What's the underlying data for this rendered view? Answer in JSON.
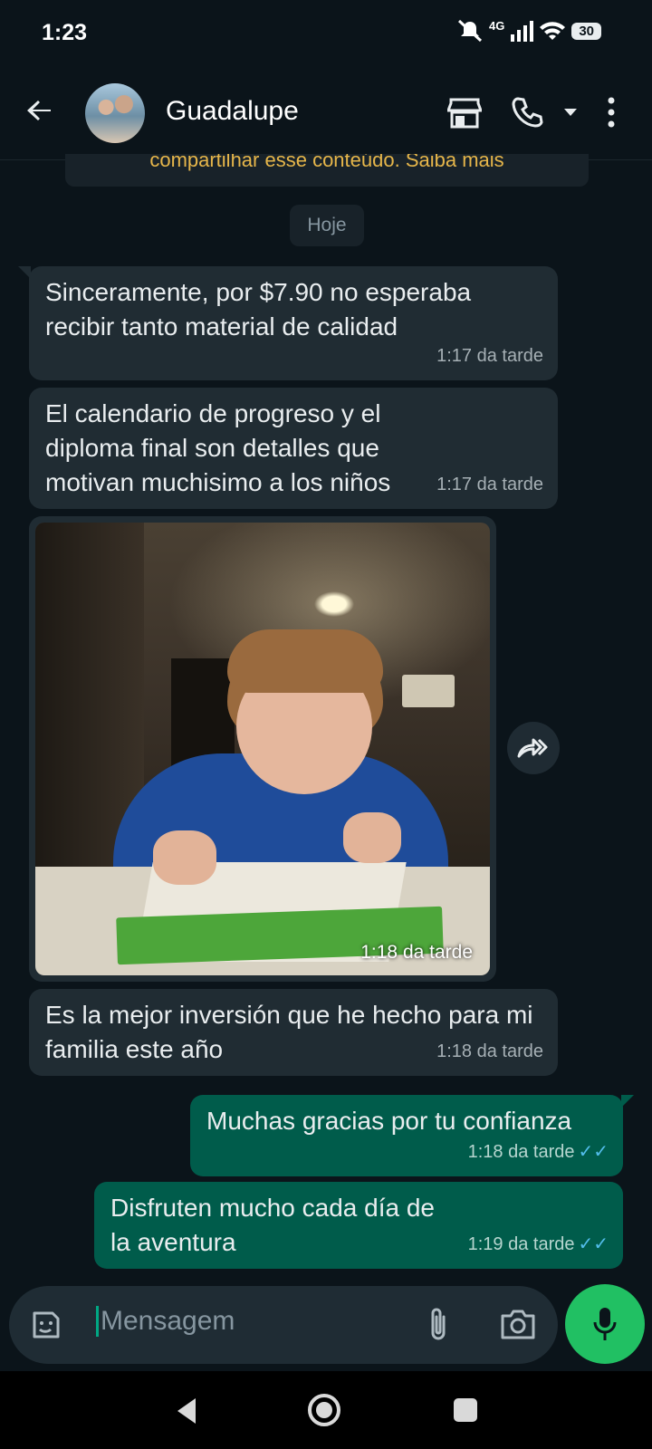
{
  "status_bar": {
    "time": "1:23",
    "network": "4G",
    "battery": "30"
  },
  "header": {
    "contact_name": "Guadalupe"
  },
  "banner": {
    "text": "compartilhar esse conteúdo. Saiba mais"
  },
  "date_chip": "Hoje",
  "messages": [
    {
      "direction": "in",
      "text": "Sinceramente, por $7.90 no esperaba recibir tanto material de calidad",
      "time": "1:17 da tarde"
    },
    {
      "direction": "in",
      "text": "El calendario de progreso y el diploma final son detalles que motivan muchisimo a los niños",
      "time": "1:17 da tarde"
    },
    {
      "direction": "in",
      "type": "image",
      "time": "1:18 da tarde"
    },
    {
      "direction": "in",
      "text": "Es la mejor inversión que he hecho para mi familia este año",
      "time": "1:18 da tarde"
    },
    {
      "direction": "out",
      "text": "Muchas gracias por tu confianza",
      "time": "1:18 da tarde",
      "status": "read"
    },
    {
      "direction": "out",
      "text": "Disfruten mucho cada día de la aventura",
      "time": "1:19 da tarde",
      "status": "read"
    }
  ],
  "composer": {
    "placeholder": "Mensagem"
  },
  "colors": {
    "background": "#0b141a",
    "incoming": "#202c33",
    "outgoing": "#005c4b",
    "accent": "#21c063",
    "read_ticks": "#53bdeb"
  },
  "icons": [
    "back-arrow-icon",
    "store-icon",
    "phone-icon",
    "dropdown-icon",
    "more-vert-icon",
    "forward-icon",
    "sticker-icon",
    "attach-icon",
    "camera-icon",
    "mic-icon",
    "nav-back-icon",
    "nav-home-icon",
    "nav-recents-icon"
  ]
}
